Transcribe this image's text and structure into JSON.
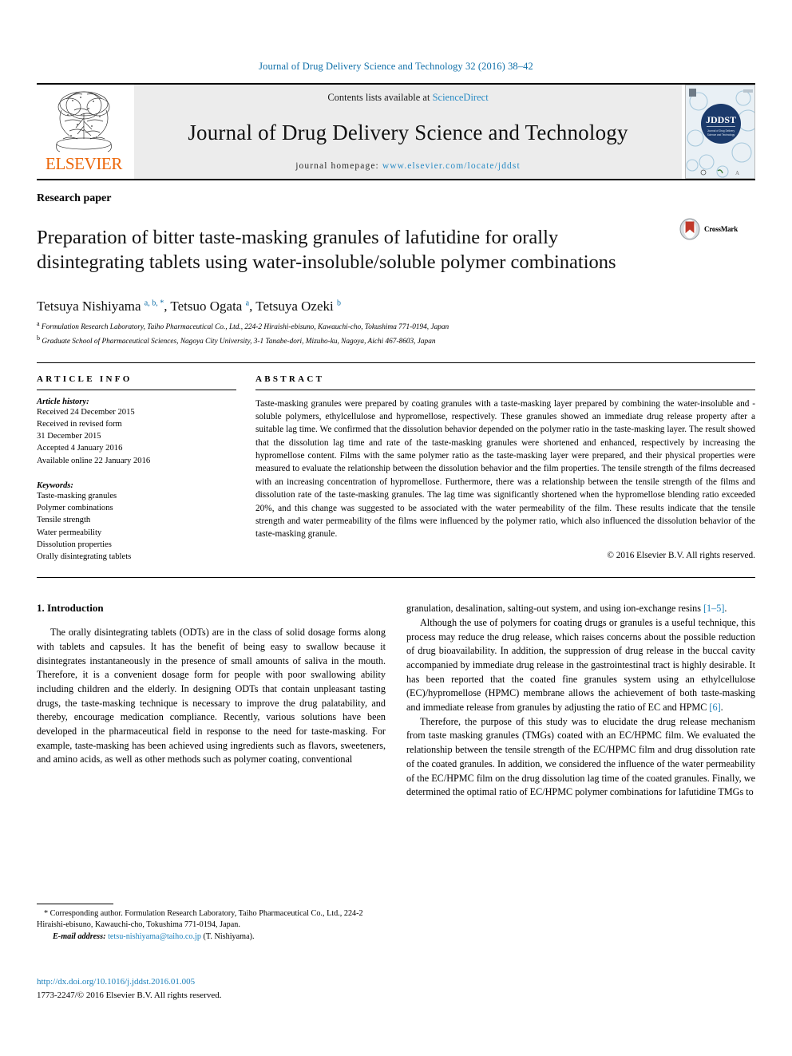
{
  "running_head": "Journal of Drug Delivery Science and Technology 32 (2016) 38–42",
  "masthead": {
    "publisher": "ELSEVIER",
    "contents_prefix": "Contents lists available at ",
    "contents_link": "ScienceDirect",
    "journal_name": "Journal of Drug Delivery Science and Technology",
    "homepage_prefix": "journal homepage: ",
    "homepage_url": "www.elsevier.com/locate/jddst",
    "cover_title": "JDDST"
  },
  "article": {
    "type": "Research paper",
    "title": "Preparation of bitter taste-masking granules of lafutidine for orally disintegrating tablets using water-insoluble/soluble polymer combinations",
    "crossmark_label": "CrossMark",
    "authors_html": "Tetsuya Nishiyama <sup>a, b, *</sup>, Tetsuo Ogata <sup>a</sup>, Tetsuya Ozeki <sup>b</sup>",
    "affiliations": [
      "Formulation Research Laboratory, Taiho Pharmaceutical Co., Ltd., 224-2 Hiraishi-ebisuno, Kawauchi-cho, Tokushima 771-0194, Japan",
      "Graduate School of Pharmaceutical Sciences, Nagoya City University, 3-1 Tanabe-dori, Mizuho-ku, Nagoya, Aichi 467-8603, Japan"
    ],
    "affiliation_markers": [
      "a",
      "b"
    ]
  },
  "article_info": {
    "heading": "ARTICLE INFO",
    "history_label": "Article history:",
    "history": [
      "Received 24 December 2015",
      "Received in revised form",
      "31 December 2015",
      "Accepted 4 January 2016",
      "Available online 22 January 2016"
    ],
    "keywords_label": "Keywords:",
    "keywords": [
      "Taste-masking granules",
      "Polymer combinations",
      "Tensile strength",
      "Water permeability",
      "Dissolution properties",
      "Orally disintegrating tablets"
    ]
  },
  "abstract": {
    "heading": "ABSTRACT",
    "text": "Taste-masking granules were prepared by coating granules with a taste-masking layer prepared by combining the water-insoluble and -soluble polymers, ethylcellulose and hypromellose, respectively. These granules showed an immediate drug release property after a suitable lag time. We confirmed that the dissolution behavior depended on the polymer ratio in the taste-masking layer. The result showed that the dissolution lag time and rate of the taste-masking granules were shortened and enhanced, respectively by increasing the hypromellose content. Films with the same polymer ratio as the taste-masking layer were prepared, and their physical properties were measured to evaluate the relationship between the dissolution behavior and the film properties. The tensile strength of the films decreased with an increasing concentration of hypromellose. Furthermore, there was a relationship between the tensile strength of the films and dissolution rate of the taste-masking granules. The lag time was significantly shortened when the hypromellose blending ratio exceeded 20%, and this change was suggested to be associated with the water permeability of the film. These results indicate that the tensile strength and water permeability of the films were influenced by the polymer ratio, which also influenced the dissolution behavior of the taste-masking granule.",
    "copyright": "© 2016 Elsevier B.V. All rights reserved."
  },
  "introduction": {
    "heading": "1. Introduction",
    "left_paragraph_1": "The orally disintegrating tablets (ODTs) are in the class of solid dosage forms along with tablets and capsules. It has the benefit of being easy to swallow because it disintegrates instantaneously in the presence of small amounts of saliva in the mouth. Therefore, it is a convenient dosage form for people with poor swallowing ability including children and the elderly. In designing ODTs that contain unpleasant tasting drugs, the taste-masking technique is necessary to improve the drug palatability, and thereby, encourage medication compliance. Recently, various solutions have been developed in the pharmaceutical field in response to the need for taste-masking. For example, taste-masking has been achieved using ingredients such as flavors, sweeteners, and amino acids, as well as other methods such as polymer coating, conventional",
    "right_paragraph_1_a": "granulation, desalination, salting-out system, and using ion-exchange resins ",
    "right_paragraph_1_ref": "[1–5]",
    "right_paragraph_1_b": ".",
    "right_paragraph_2_a": "Although the use of polymers for coating drugs or granules is a useful technique, this process may reduce the drug release, which raises concerns about the possible reduction of drug bioavailability. In addition, the suppression of drug release in the buccal cavity accompanied by immediate drug release in the gastrointestinal tract is highly desirable. It has been reported that the coated fine granules system using an ethylcellulose (EC)/hypromellose (HPMC) membrane allows the achievement of both taste-masking and immediate release from granules by adjusting the ratio of EC and HPMC ",
    "right_paragraph_2_ref": "[6]",
    "right_paragraph_2_b": ".",
    "right_paragraph_3": "Therefore, the purpose of this study was to elucidate the drug release mechanism from taste masking granules (TMGs) coated with an EC/HPMC film. We evaluated the relationship between the tensile strength of the EC/HPMC film and drug dissolution rate of the coated granules. In addition, we considered the influence of the water permeability of the EC/HPMC film on the drug dissolution lag time of the coated granules. Finally, we determined the optimal ratio of EC/HPMC polymer combinations for lafutidine TMGs to"
  },
  "footer": {
    "corresponding_marker": "*",
    "corresponding_text": "Corresponding author. Formulation Research Laboratory, Taiho Pharmaceutical Co., Ltd., 224-2 Hiraishi-ebisuno, Kawauchi-cho, Tokushima 771-0194, Japan.",
    "email_label": "E-mail address:",
    "email": "tetsu-nishiyama@taiho.co.jp",
    "email_suffix": "(T. Nishiyama).",
    "doi": "http://dx.doi.org/10.1016/j.jddst.2016.01.005",
    "issn_line": "1773-2247/© 2016 Elsevier B.V. All rights reserved."
  },
  "colors": {
    "link_blue": "#1a7fba",
    "header_blue": "#0f6fa8",
    "elsevier_orange": "#ec6608",
    "masthead_grey": "#ececec"
  }
}
